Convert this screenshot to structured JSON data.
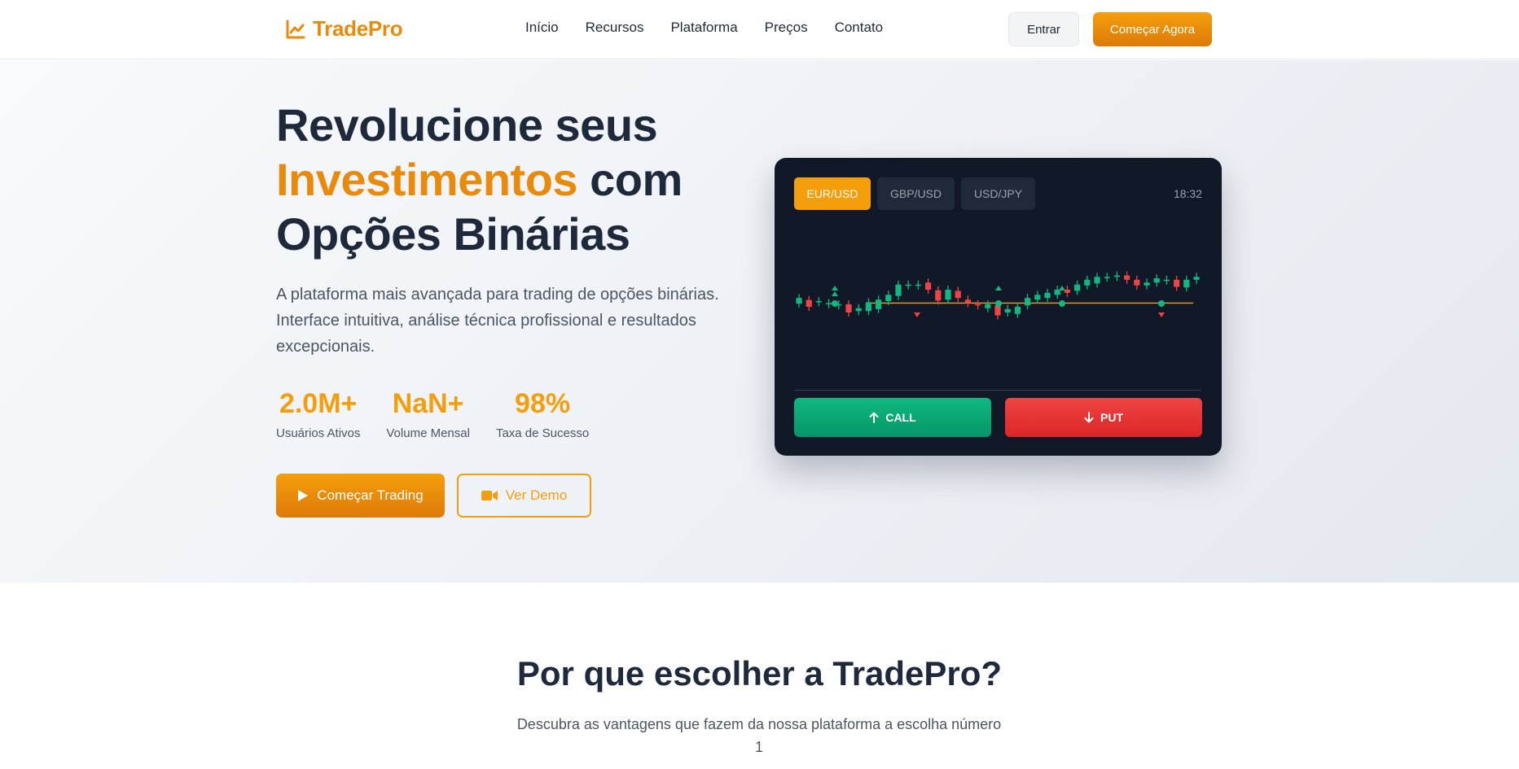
{
  "nav": {
    "brand": "TradePro",
    "links": [
      "Início",
      "Recursos",
      "Plataforma",
      "Preços",
      "Contato"
    ],
    "login_label": "Entrar",
    "cta_label": "Começar Agora"
  },
  "hero": {
    "title_part1": "Revolucione seus",
    "title_accent": "Investimentos",
    "title_part2": "com",
    "title_part3": "Opções Binárias",
    "subtitle": "A plataforma mais avançada para trading de opções binárias. Interface intuitiva, análise técnica profissional e resultados excepcionais.",
    "stats": [
      {
        "value": "2.0M+",
        "label": "Usuários Ativos"
      },
      {
        "value": "NaN+",
        "label": "Volume Mensal"
      },
      {
        "value": "98%",
        "label": "Taxa de Sucesso"
      }
    ],
    "primary_button": "Começar Trading",
    "secondary_button": "Ver Demo"
  },
  "trading_card": {
    "pairs": [
      "EUR/USD",
      "GBP/USD",
      "USD/JPY"
    ],
    "active_pair": "EUR/USD",
    "time": "18:32",
    "call_label": "CALL",
    "put_label": "PUT",
    "colors": {
      "up": "#10b981",
      "down": "#ef4444",
      "accent": "#f59e0b"
    }
  },
  "features": {
    "title": "Por que escolher a TradePro?",
    "subtitle": "Descubra as vantagens que fazem da nossa plataforma a escolha número 1"
  },
  "chart_data": {
    "type": "candlestick",
    "candles": [
      {
        "o": 0.31,
        "c": 0.51
      },
      {
        "o": 0.44,
        "c": 0.2
      },
      {
        "o": 0.36,
        "c": 0.4
      },
      {
        "o": 0.29,
        "c": 0.33
      },
      {
        "o": 0.25,
        "c": 0.29
      },
      {
        "o": 0.29,
        "c": 0.0
      },
      {
        "o": 0.05,
        "c": 0.15
      },
      {
        "o": 0.05,
        "c": 0.36
      },
      {
        "o": 0.12,
        "c": 0.45
      },
      {
        "o": 0.4,
        "c": 0.62
      },
      {
        "o": 0.58,
        "c": 0.98
      },
      {
        "o": 0.95,
        "c": 0.98
      },
      {
        "o": 0.95,
        "c": 0.98
      },
      {
        "o": 1.05,
        "c": 0.8
      },
      {
        "o": 0.78,
        "c": 0.42
      },
      {
        "o": 0.45,
        "c": 0.8
      },
      {
        "o": 0.76,
        "c": 0.51
      },
      {
        "o": 0.45,
        "c": 0.33
      },
      {
        "o": 0.29,
        "c": 0.25
      },
      {
        "o": 0.15,
        "c": 0.29
      },
      {
        "o": 0.25,
        "c": -0.1
      },
      {
        "o": 0.0,
        "c": 0.12
      },
      {
        "o": -0.05,
        "c": 0.2
      },
      {
        "o": 0.25,
        "c": 0.51
      },
      {
        "o": 0.45,
        "c": 0.62
      },
      {
        "o": 0.51,
        "c": 0.69
      },
      {
        "o": 0.62,
        "c": 0.8
      },
      {
        "o": 0.8,
        "c": 0.69
      },
      {
        "o": 0.76,
        "c": 0.98
      },
      {
        "o": 0.95,
        "c": 1.15
      },
      {
        "o": 1.02,
        "c": 1.25
      },
      {
        "o": 1.22,
        "c": 1.25
      },
      {
        "o": 1.25,
        "c": 1.3
      },
      {
        "o": 1.3,
        "c": 1.15
      },
      {
        "o": 1.15,
        "c": 0.95
      },
      {
        "o": 0.95,
        "c": 1.05
      },
      {
        "o": 1.05,
        "c": 1.2
      },
      {
        "o": 1.12,
        "c": 1.15
      },
      {
        "o": 1.15,
        "c": 0.9
      },
      {
        "o": 0.88,
        "c": 1.15
      },
      {
        "o": 1.15,
        "c": 1.25
      }
    ],
    "trigger_level": 0.33
  }
}
